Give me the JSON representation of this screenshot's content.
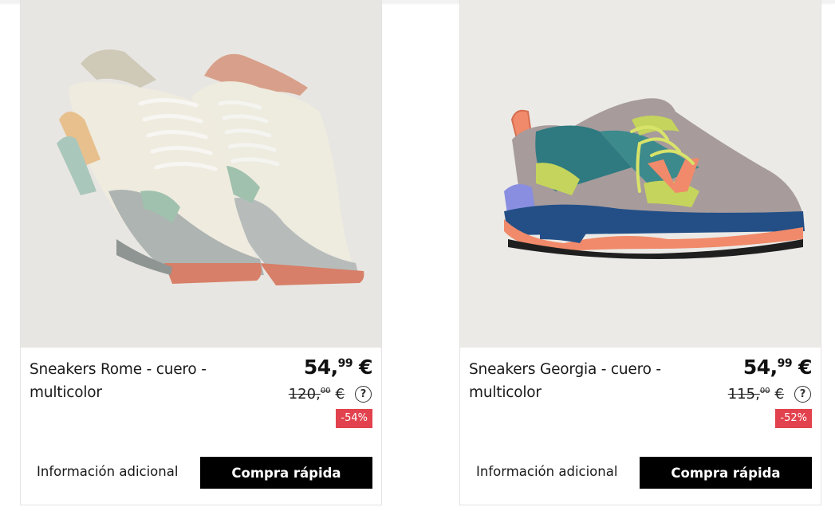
{
  "products": [
    {
      "title_line1": "Sneakers Rome - cuero -",
      "title_line2": "multicolor",
      "price_whole": "54,",
      "price_decimals": "99",
      "price_currency": "€",
      "old_price_whole": "120,",
      "old_price_decimals": "00",
      "old_price_currency": "€",
      "discount": "-54%",
      "help_symbol": "?",
      "info_label": "Información adicional",
      "buy_label": "Compra rápida"
    },
    {
      "title_line1": "Sneakers Georgia - cuero -",
      "title_line2": "multicolor",
      "price_whole": "54,",
      "price_decimals": "99",
      "price_currency": "€",
      "old_price_whole": "115,",
      "old_price_decimals": "00",
      "old_price_currency": "€",
      "discount": "-52%",
      "help_symbol": "?",
      "info_label": "Información adicional",
      "buy_label": "Compra rápida"
    }
  ],
  "colors": {
    "discount_badge": "#e2424e",
    "button_bg": "#000000",
    "image_bg": "#e9e7e3"
  },
  "icons": [
    "question-circle-icon"
  ]
}
